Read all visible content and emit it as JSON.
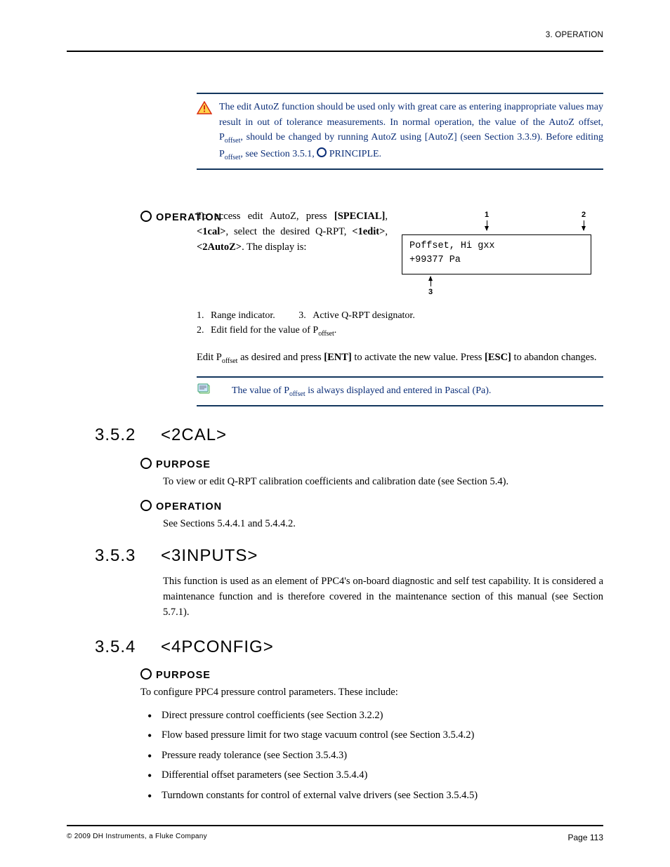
{
  "header": {
    "right": "3.  OPERATION"
  },
  "warning": {
    "text_parts": [
      "The edit AutoZ function should be used only with great care as entering inappropriate values may result in out of tolerance measurements.  In normal operation, the value of the AutoZ offset, P",
      "offset",
      ", should be changed by running AutoZ using [AutoZ] (seen Section 3.3.9).  Before editing P",
      "offset",
      ", see Section 3.5.1, ",
      " PRINCIPLE."
    ]
  },
  "operation": {
    "label_left": "OPERATION",
    "para1_parts": [
      "To access edit AutoZ, press ",
      "[SPECIAL]",
      ", ",
      "<1cal>",
      ", select the desired Q-RPT, ",
      "<1edit>",
      ", ",
      "<2AutoZ>",
      ".  The display is:"
    ],
    "diagram": {
      "label1": "1",
      "label2": "2",
      "label3": "3",
      "line1": "Poffset, Hi gxx",
      "line2": "+99377 Pa"
    },
    "legend": {
      "l1": "Range indicator.",
      "l2_a": "Edit field for the value of P",
      "l2_sub": "offset",
      "l2_b": ".",
      "l3": "Active Q-RPT designator."
    },
    "para2_parts": [
      "Edit P",
      "offset",
      " as desired and press ",
      "[ENT]",
      " to activate the new value.  Press ",
      "[ESC]",
      " to abandon changes."
    ]
  },
  "note": {
    "text_parts": [
      "The value of P",
      "offset",
      " is always displayed and entered in Pascal (Pa)."
    ]
  },
  "section": {
    "num": "3.5.2",
    "title": "<2CAL>"
  },
  "purpose": {
    "label": "PURPOSE",
    "text": "To view or edit Q-RPT calibration coefficients and calibration date (see Section 5.4)."
  },
  "operation2": {
    "label": "OPERATION",
    "text": "See Sections 5.4.4.1 and 5.4.4.2."
  },
  "section2": {
    "num": "3.5.3",
    "title": "<3INPUTS>",
    "body": "This function is used as an element of PPC4's on-board diagnostic and self test capability.  It is considered a maintenance function and is therefore covered in the maintenance section of this manual (see Section 5.7.1)."
  },
  "section3": {
    "num": "3.5.4",
    "title": "<4PCONFIG>"
  },
  "purpose3": {
    "label": "PURPOSE",
    "text": "To configure PPC4 pressure control parameters.  These include:",
    "items": [
      "Direct pressure control coefficients (see Section 3.2.2)",
      "Flow based pressure limit for two stage vacuum control (see Section 3.5.4.2)",
      "Pressure ready tolerance (see Section 3.5.4.3)",
      "Differential offset parameters (see Section 3.5.4.4)",
      "Turndown constants for control of external valve drivers (see Section 3.5.4.5)"
    ]
  },
  "footer": {
    "left": "© 2009 DH Instruments, a Fluke Company",
    "right": "Page 113"
  }
}
